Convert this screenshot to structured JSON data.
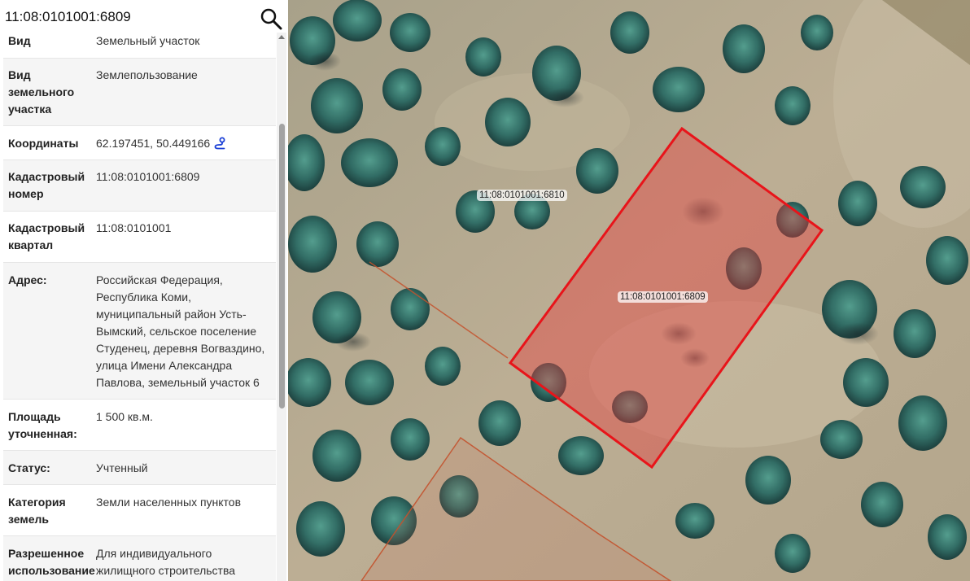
{
  "search": {
    "value": "11:08:0101001:6809"
  },
  "details": [
    {
      "label": "Вид",
      "value": "Земельный участок"
    },
    {
      "label": "Вид\nземельного\nучастка",
      "value": "Землепользование"
    },
    {
      "label": "Координаты",
      "value": "62.197451, 50.449166"
    },
    {
      "label": "Кадастровый\nномер",
      "value": "11:08:0101001:6809"
    },
    {
      "label": "Кадастровый\nквартал",
      "value": "11:08:0101001"
    },
    {
      "label": "Адрес:",
      "value": "Российская Федерация,\nРеспублика Коми,\nмуниципальный район Усть-\nВымский, сельское поселение\nСтуденец, деревня Вогваздино,\nулица Имени Александра\nПавлова, земельный участок 6"
    },
    {
      "label": "Площадь\nуточненная:",
      "value": "1 500 кв.м."
    },
    {
      "label": "Статус:",
      "value": "Учтенный"
    },
    {
      "label": "Категория\nземель",
      "value": "Земли населенных пунктов"
    },
    {
      "label": "Разрешенное\nиспользование",
      "value": "Для индивидуального\nжилищного строительства"
    }
  ],
  "map": {
    "parcels": [
      {
        "id": "11:08:0101001:6810",
        "selected": false
      },
      {
        "id": "11:08:0101001:6809",
        "selected": true
      }
    ],
    "colors": {
      "selected_outline": "#e8141a",
      "selected_fill": "rgba(232,60,60,0.42)",
      "neighbor_outline": "#c4522d"
    }
  },
  "icons": {
    "search": "search-icon",
    "coordinates_link": "map-route-icon"
  }
}
